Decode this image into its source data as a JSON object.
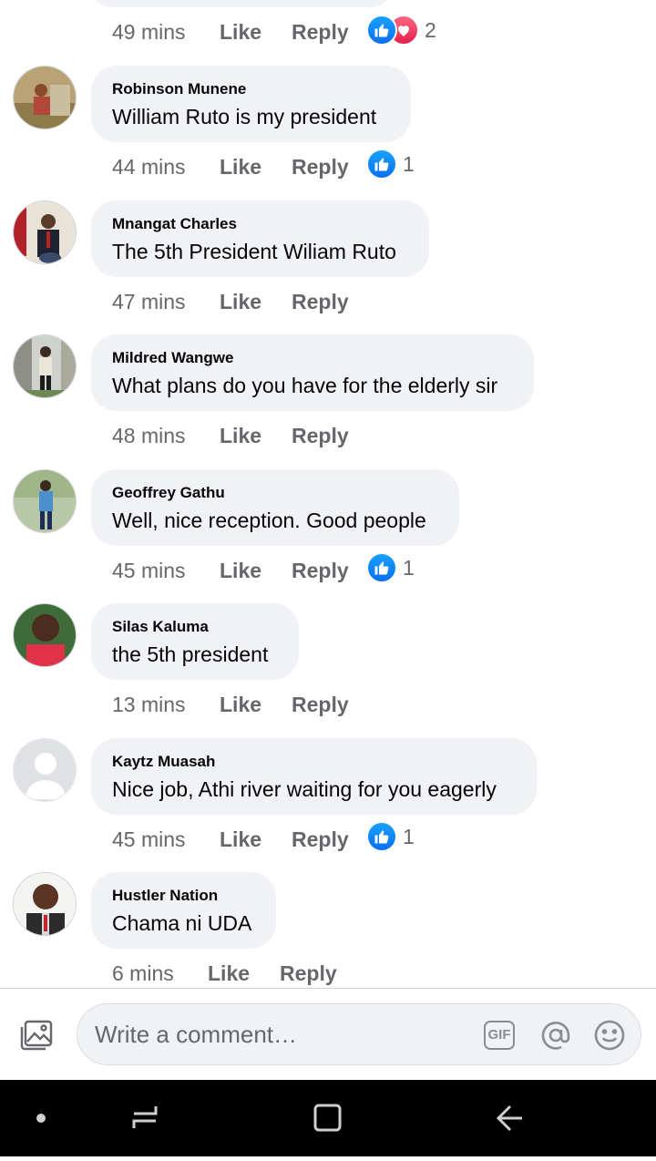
{
  "previous_comment": {
    "time": "49 mins",
    "like_label": "Like",
    "reply_label": "Reply",
    "reaction_count": "2",
    "reactions": [
      "like",
      "love"
    ]
  },
  "comments": [
    {
      "author": "Robinson Munene",
      "text": "William Ruto is my president",
      "time": "44 mins",
      "like_label": "Like",
      "reply_label": "Reply",
      "reaction_count": "1",
      "avatar": "photo"
    },
    {
      "author": "Mnangat Charles",
      "text": "The 5th President Wiliam Ruto",
      "time": "47 mins",
      "like_label": "Like",
      "reply_label": "Reply",
      "reaction_count": "",
      "avatar": "photo"
    },
    {
      "author": "Mildred Wangwe",
      "text": "What plans do you have for the elderly sir",
      "time": "48 mins",
      "like_label": "Like",
      "reply_label": "Reply",
      "reaction_count": "",
      "avatar": "photo"
    },
    {
      "author": "Geoffrey Gathu",
      "text": "Well, nice reception. Good people",
      "time": "45 mins",
      "like_label": "Like",
      "reply_label": "Reply",
      "reaction_count": "1",
      "avatar": "photo"
    },
    {
      "author": "Silas Kaluma",
      "text": "the 5th president",
      "time": "13 mins",
      "like_label": "Like",
      "reply_label": "Reply",
      "reaction_count": "",
      "avatar": "photo"
    },
    {
      "author": "Kaytz Muasah",
      "text": "Nice job, Athi river waiting for you eagerly",
      "time": "45 mins",
      "like_label": "Like",
      "reply_label": "Reply",
      "reaction_count": "1",
      "avatar": "default-user-icon"
    },
    {
      "author": "Hustler Nation",
      "text": "Chama ni UDA",
      "time": "6 mins",
      "like_label": "Like",
      "reply_label": "Reply",
      "reaction_count": "",
      "avatar": "photo"
    }
  ],
  "composer": {
    "placeholder": "Write a comment…",
    "gif_label": "GIF",
    "icons": [
      "photo-icon",
      "gif-icon",
      "mention-icon",
      "emoji-icon"
    ]
  },
  "navbar": {
    "icons": [
      "dot-icon",
      "recent-apps-icon",
      "home-icon",
      "back-icon"
    ]
  },
  "colors": {
    "bubble": "#f0f2f5",
    "meta_text": "#65676b",
    "like_blue": "#0b6ff0",
    "love_red": "#e61e4d"
  }
}
